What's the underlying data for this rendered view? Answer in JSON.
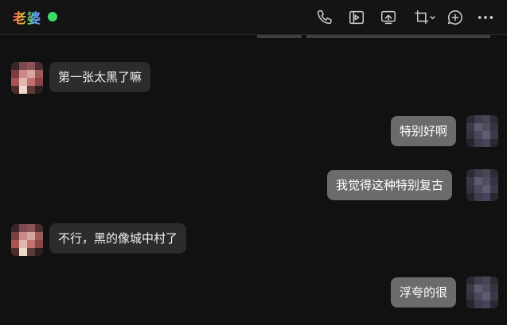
{
  "header": {
    "title": "老婆",
    "icons": [
      "phone-icon",
      "video-call-icon",
      "screen-share-icon",
      "screen-capture-icon",
      "add-chat-icon",
      "more-icon"
    ]
  },
  "colors": {
    "background": "#111111",
    "bubble_left": "#2c2c2c",
    "bubble_right": "#6b6b6b",
    "online": "#3ddc6a"
  },
  "messages": [
    {
      "side": "left",
      "text": "第一张太黑了嘛"
    },
    {
      "side": "right",
      "text": "特别好啊"
    },
    {
      "side": "right",
      "text": "我觉得这种特别复古"
    },
    {
      "side": "left",
      "text": "不行，黑的像城中村了"
    },
    {
      "side": "right",
      "text": "浮夸的很"
    }
  ]
}
